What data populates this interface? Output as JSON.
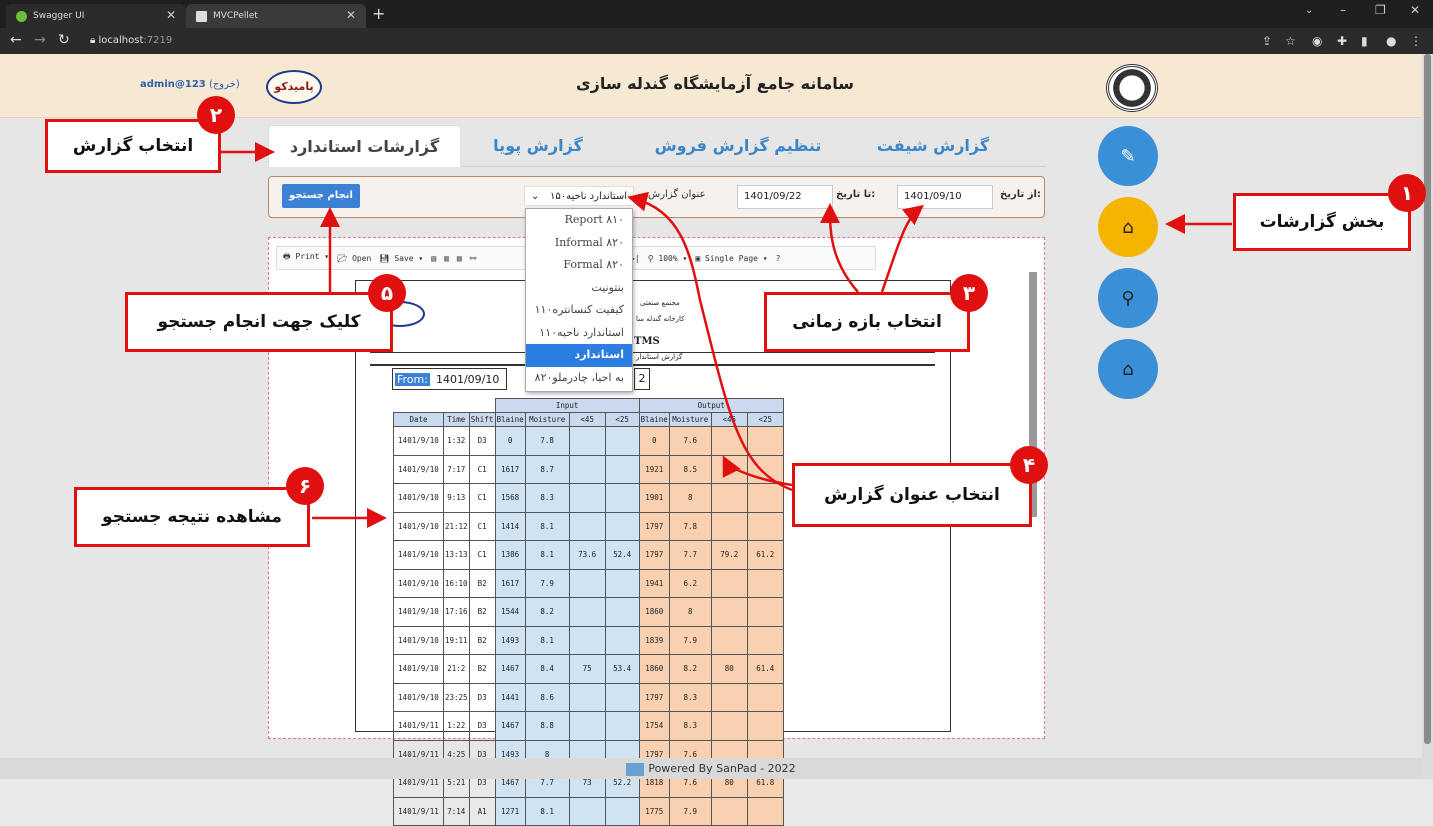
{
  "browser": {
    "tabs": [
      {
        "title": "Swagger UI"
      },
      {
        "title": "MVCPellet"
      }
    ],
    "url_host": "localhost",
    "url_port": ":7219"
  },
  "header": {
    "title": "سامانه جامع آزمایشگاه گندله سازی",
    "user": "admin@123",
    "logout": "(خروج)",
    "company_logo": "پامیدکو"
  },
  "report_tabs": [
    "گزارش شیفت",
    "تنظیم گزارش فروش",
    "گزارش پویا",
    "گزارشات استاندارد"
  ],
  "filter": {
    "from_label": "از تاریخ:",
    "from_value": "1401/09/10",
    "to_label": "تا تاریخ:",
    "to_value": "1401/09/22",
    "title_label": "عنوان گزارش",
    "selected": "استاندارد ناحیه۱۵۰",
    "search_button": "انجام جستجو"
  },
  "dropdown_options": [
    "Report ۸۱۰",
    "Informal ۸۲۰",
    "Formal ۸۲۰",
    "بنتونیت",
    "کیفیت کنسانتره۱۱۰",
    "استاندارد ناحیه۱۱۰",
    "استاندارد ناحیه۱۵۰",
    "۸۲۰به احیا، چادرملو"
  ],
  "dropdown_selected_index": 6,
  "toolbar": [
    "Print",
    "Open",
    "Save",
    "5",
    "100%",
    "Single Page",
    "?"
  ],
  "report": {
    "header_line1": "مجتمع صنعتی",
    "header_line2": "کارخانه گندله سا",
    "tms": "TMS",
    "subtitle": "گزارش استاندار",
    "from_key": "From:",
    "from_val": "1401/09/10",
    "to_tail": "2",
    "group_input": "Input",
    "group_output": "Output",
    "columns": [
      "Date",
      "Time",
      "Shift",
      "Blaine",
      "Moisture",
      "<45",
      "<25",
      "Blaine",
      "Moisture",
      "<45",
      "<25"
    ],
    "rows": [
      [
        "1401/9/10",
        "1:32",
        "D3",
        "0",
        "7.8",
        "",
        "",
        "0",
        "7.6",
        "",
        ""
      ],
      [
        "1401/9/10",
        "7:17",
        "C1",
        "1617",
        "8.7",
        "",
        "",
        "1921",
        "8.5",
        "",
        ""
      ],
      [
        "1401/9/10",
        "9:13",
        "C1",
        "1568",
        "8.3",
        "",
        "",
        "1901",
        "8",
        "",
        ""
      ],
      [
        "1401/9/10",
        "21:12",
        "C1",
        "1414",
        "8.1",
        "",
        "",
        "1797",
        "7.8",
        "",
        ""
      ],
      [
        "1401/9/10",
        "13:13",
        "C1",
        "1386",
        "8.1",
        "73.6",
        "52.4",
        "1797",
        "7.7",
        "79.2",
        "61.2"
      ],
      [
        "1401/9/10",
        "16:10",
        "B2",
        "1617",
        "7.9",
        "",
        "",
        "1941",
        "6.2",
        "",
        ""
      ],
      [
        "1401/9/10",
        "17:16",
        "B2",
        "1544",
        "8.2",
        "",
        "",
        "1860",
        "8",
        "",
        ""
      ],
      [
        "1401/9/10",
        "19:11",
        "B2",
        "1493",
        "8.1",
        "",
        "",
        "1839",
        "7.9",
        "",
        ""
      ],
      [
        "1401/9/10",
        "21:2",
        "B2",
        "1467",
        "8.4",
        "75",
        "53.4",
        "1860",
        "8.2",
        "80",
        "61.4"
      ],
      [
        "1401/9/10",
        "23:25",
        "D3",
        "1441",
        "8.6",
        "",
        "",
        "1797",
        "8.3",
        "",
        ""
      ],
      [
        "1401/9/11",
        "1:22",
        "D3",
        "1467",
        "8.8",
        "",
        "",
        "1754",
        "8.3",
        "",
        ""
      ],
      [
        "1401/9/11",
        "4:25",
        "D3",
        "1493",
        "8",
        "",
        "",
        "1797",
        "7.6",
        "",
        ""
      ],
      [
        "1401/9/11",
        "5:21",
        "D3",
        "1467",
        "7.7",
        "73",
        "52.2",
        "1818",
        "7.6",
        "80",
        "61.8"
      ],
      [
        "1401/9/11",
        "7:14",
        "A1",
        "1271",
        "8.1",
        "",
        "",
        "1775",
        "7.9",
        "",
        ""
      ]
    ]
  },
  "annotations": [
    {
      "n": "۱",
      "text": "بخش گزارشات"
    },
    {
      "n": "۲",
      "text": "انتخاب گزارش"
    },
    {
      "n": "۳",
      "text": "انتخاب بازه زمانی"
    },
    {
      "n": "۴",
      "text": "انتخاب عنوان گزارش"
    },
    {
      "n": "۵",
      "text": "کلیک جهت انجام جستجو"
    },
    {
      "n": "۶",
      "text": "مشاهده نتیجه جستجو"
    }
  ],
  "footer": "Powered By SanPad - 2022",
  "colors": {
    "accent_red": "#e01010",
    "side_blue": "#3b8fd6",
    "side_active": "#f4b400",
    "header_bg": "#f6e8d2"
  }
}
